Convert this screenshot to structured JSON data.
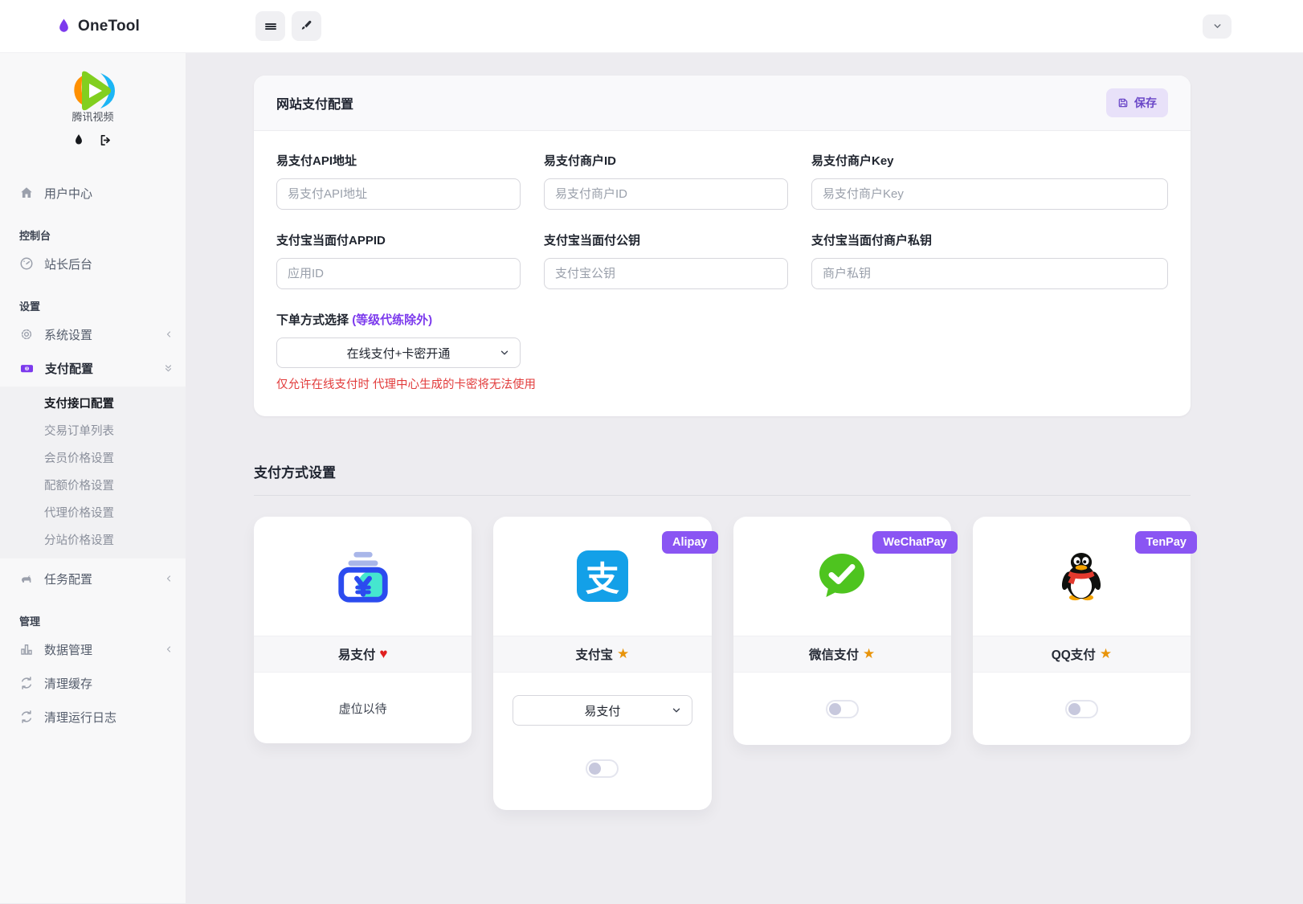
{
  "topbar": {
    "brand": "OneTool"
  },
  "sidebar": {
    "logo_caption": "腾讯视频",
    "nav": [
      {
        "label": "用户中心"
      },
      {
        "label": "控制台"
      },
      {
        "label": "站长后台"
      },
      {
        "label": "设置"
      },
      {
        "label": "系统设置"
      },
      {
        "label": "支付配置"
      },
      {
        "label": "支付接口配置"
      },
      {
        "label": "交易订单列表"
      },
      {
        "label": "会员价格设置"
      },
      {
        "label": "配额价格设置"
      },
      {
        "label": "代理价格设置"
      },
      {
        "label": "分站价格设置"
      },
      {
        "label": "任务配置"
      },
      {
        "label": "管理"
      },
      {
        "label": "数据管理"
      },
      {
        "label": "清理缓存"
      },
      {
        "label": "清理运行日志"
      }
    ]
  },
  "form": {
    "title": "网站支付配置",
    "save_label": "保存",
    "fields": [
      {
        "label": "易支付API地址",
        "placeholder": "易支付API地址",
        "value": ""
      },
      {
        "label": "易支付商户ID",
        "placeholder": "易支付商户ID",
        "value": ""
      },
      {
        "label": "易支付商户Key",
        "placeholder": "易支付商户Key",
        "value": ""
      },
      {
        "label": "支付宝当面付APPID",
        "placeholder": "应用ID",
        "value": ""
      },
      {
        "label": "支付宝当面付公钥",
        "placeholder": "支付宝公钥",
        "value": ""
      },
      {
        "label": "支付宝当面付商户私钥",
        "placeholder": "商户私钥",
        "value": ""
      }
    ],
    "order_method": {
      "label": "下单方式选择",
      "label_note": "(等级代练除外)",
      "value": "在线支付+卡密开通",
      "warning": "仅允许在线支付时 代理中心生成的卡密将无法使用"
    }
  },
  "payment_methods": {
    "title": "支付方式设置",
    "cards": [
      {
        "name": "易支付",
        "suffix_glyph": "♥",
        "body_text": "虚位以待"
      },
      {
        "name": "支付宝",
        "suffix_glyph": "★",
        "badge": "Alipay",
        "select_value": "易支付",
        "toggle_on": false
      },
      {
        "name": "微信支付",
        "suffix_glyph": "★",
        "badge": "WeChatPay",
        "toggle_on": false
      },
      {
        "name": "QQ支付",
        "suffix_glyph": "★",
        "badge": "TenPay",
        "toggle_on": false
      }
    ],
    "alipay_glyph": "支"
  },
  "colors": {
    "accent_purple": "#7c3aed",
    "badge_purple": "#8a55f3",
    "warning_red": "#e23c3c",
    "heart_red": "#e02020",
    "star_orange": "#e8940a",
    "alipay_blue": "#13a0e8",
    "wechat_green": "#4ec41f"
  }
}
